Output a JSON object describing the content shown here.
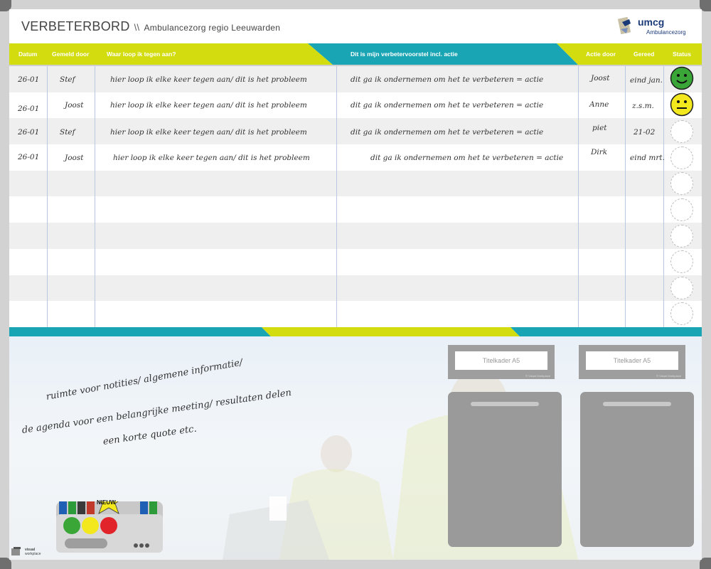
{
  "header": {
    "title": "VERBETERBORD",
    "separator": "\\\\",
    "subtitle": "Ambulancezorg regio Leeuwarden",
    "logo_text": "umcg",
    "logo_subtext": "Ambulancezorg"
  },
  "columns": {
    "datum": "Datum",
    "gemeld_door": "Gemeld door",
    "waar_loop": "Waar loop ik tegen aan?",
    "voorstel": "Dit is mijn verbetervoorstel incl. actie",
    "actie_door": "Actie door",
    "gereed": "Gereed",
    "status": "Status"
  },
  "rows": [
    {
      "datum": "26-01",
      "gemeld": "Stef",
      "probleem": "hier loop ik elke keer tegen aan/ dit is het probleem",
      "actie": "dit ga ik ondernemen om het te verbeteren = actie",
      "actie_door": "Joost",
      "gereed": "eind jan.",
      "status": "green"
    },
    {
      "datum": "26-01",
      "gemeld": "Joost",
      "probleem": "hier loop ik elke keer tegen aan/ dit is het probleem",
      "actie": "dit ga ik ondernemen om het te verbeteren = actie",
      "actie_door": "Anne",
      "gereed": "z.s.m.",
      "status": "yellow"
    },
    {
      "datum": "26-01",
      "gemeld": "Stef",
      "probleem": "hier loop ik elke keer tegen aan/ dit is het probleem",
      "actie": "dit ga ik ondernemen om het te verbeteren = actie",
      "actie_door": "piet",
      "gereed": "21-02",
      "status": "empty"
    },
    {
      "datum": "26-01",
      "gemeld": "Joost",
      "probleem": "hier loop ik elke keer tegen aan/ dit is het probleem",
      "actie": "dit ga ik ondernemen om het te verbeteren = actie",
      "actie_door": "Dirk",
      "gereed": "eind mrt.",
      "status": "empty"
    }
  ],
  "notes": {
    "line1": "ruimte voor notities/ algemene informatie/",
    "line2": "de agenda voor een belangrijke meeting/ resultaten delen",
    "line3": "een korte quote etc."
  },
  "titelkaders": [
    "Titelkader A5",
    "Titelkader A5"
  ],
  "titelkader_brand": "© Visual Workplace",
  "pen_tray_badge": "NIEUW",
  "brand": {
    "line1": "visual",
    "line2": "workplace"
  },
  "colors": {
    "lime": "#d3dc0f",
    "teal": "#1aa5b4",
    "green_face": "#3aa637",
    "yellow_face": "#f3e81d",
    "red_face": "#e0242a"
  }
}
